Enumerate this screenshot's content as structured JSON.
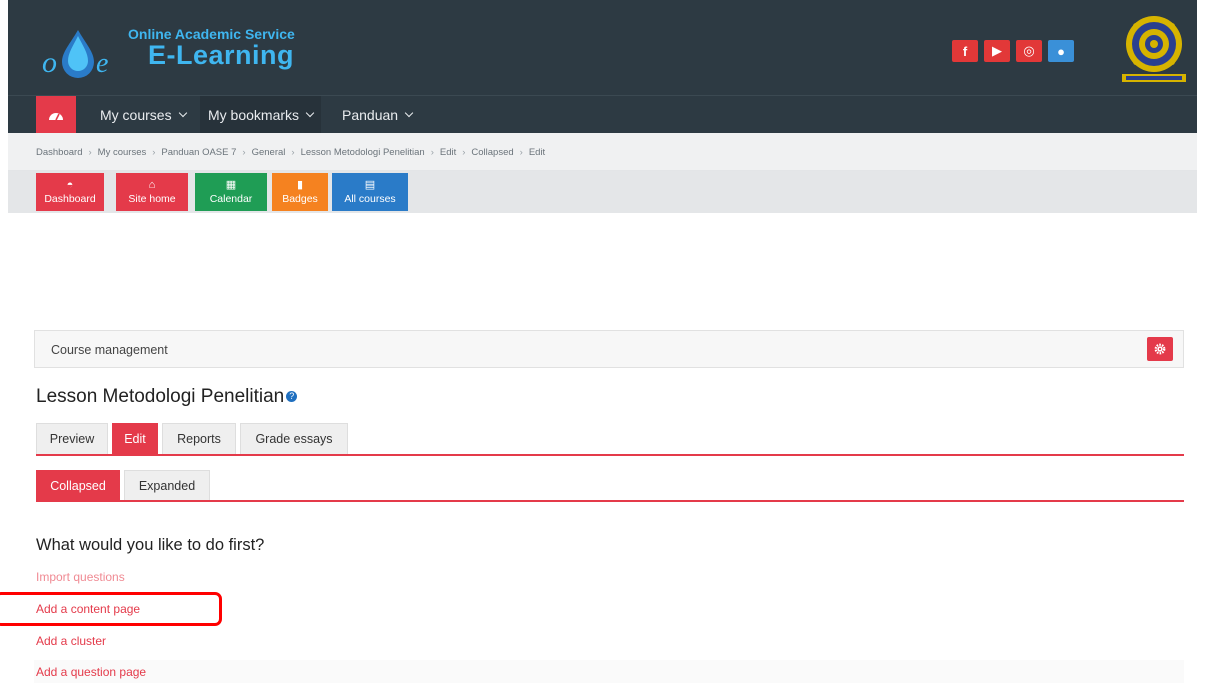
{
  "header": {
    "logo_small": "Online Academic Service",
    "logo_big": "E-Learning",
    "social": [
      {
        "name": "facebook",
        "glyph": "f"
      },
      {
        "name": "youtube",
        "glyph": "▶"
      },
      {
        "name": "instagram",
        "glyph": "◎"
      },
      {
        "name": "website",
        "glyph": "●"
      }
    ],
    "colors": {
      "bar": "#2d3a43",
      "accent": "#e43a4a",
      "logo": "#3fb6f0"
    }
  },
  "nav": {
    "home_icon": "dashboard-icon",
    "items": [
      {
        "label": "My courses"
      },
      {
        "label": "My bookmarks"
      },
      {
        "label": "Panduan"
      }
    ]
  },
  "breadcrumb": [
    "Dashboard",
    "My courses",
    "Panduan OASE 7",
    "General",
    "Lesson Metodologi Penelitian",
    "Edit",
    "Collapsed",
    "Edit"
  ],
  "quick_buttons": [
    {
      "label": "Dashboard",
      "icon": "dashboard-icon",
      "color": "#e43a4a"
    },
    {
      "label": "Site home",
      "icon": "home-icon",
      "color": "#e43a4a"
    },
    {
      "label": "Calendar",
      "icon": "calendar-icon",
      "color": "#1f9d55"
    },
    {
      "label": "Badges",
      "icon": "bookmark-icon",
      "color": "#f58220"
    },
    {
      "label": "All courses",
      "icon": "book-icon",
      "color": "#2a7bc8"
    }
  ],
  "course_management": {
    "label": "Course management"
  },
  "lesson": {
    "title": "Lesson Metodologi Penelitian"
  },
  "tabs": [
    {
      "label": "Preview",
      "active": false
    },
    {
      "label": "Edit",
      "active": true
    },
    {
      "label": "Reports",
      "active": false
    },
    {
      "label": "Grade essays",
      "active": false
    }
  ],
  "subtabs": [
    {
      "label": "Collapsed",
      "active": true
    },
    {
      "label": "Expanded",
      "active": false
    }
  ],
  "question": {
    "title": "What would you like to do first?",
    "links": [
      {
        "label": "Import questions"
      },
      {
        "label": "Add a content page"
      },
      {
        "label": "Add a cluster"
      },
      {
        "label": "Add a question page"
      }
    ]
  }
}
